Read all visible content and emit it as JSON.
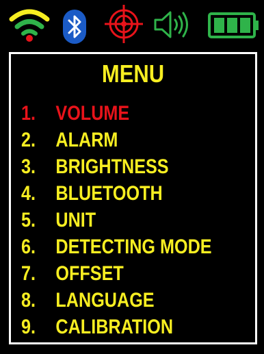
{
  "status_bar": {
    "icons": [
      "wifi-icon",
      "bluetooth-icon",
      "target-icon",
      "speaker-volume-icon",
      "battery-icon"
    ],
    "colors": {
      "wifi_top": "#f7ee21",
      "wifi_middle": "#2fb34a",
      "wifi_dot": "#e8131a",
      "bluetooth_badge": "#1b5bc6",
      "target": "#e8131a",
      "speaker": "#2fb34a",
      "battery": "#2fb34a"
    },
    "battery_level": 1.0
  },
  "menu": {
    "title": "MENU",
    "selected_index": 0,
    "items": [
      {
        "number": "1.",
        "label": "VOLUME"
      },
      {
        "number": "2.",
        "label": "ALARM"
      },
      {
        "number": "3.",
        "label": "BRIGHTNESS"
      },
      {
        "number": "4.",
        "label": "BLUETOOTH"
      },
      {
        "number": "5.",
        "label": "UNIT"
      },
      {
        "number": "6.",
        "label": "DETECTING MODE"
      },
      {
        "number": "7.",
        "label": "OFFSET"
      },
      {
        "number": "8.",
        "label": "LANGUAGE"
      },
      {
        "number": "9.",
        "label": "CALIBRATION"
      }
    ],
    "colors": {
      "text": "#f7ee21",
      "selected": "#e8131a",
      "border": "#ffffff",
      "background": "#000000"
    }
  }
}
